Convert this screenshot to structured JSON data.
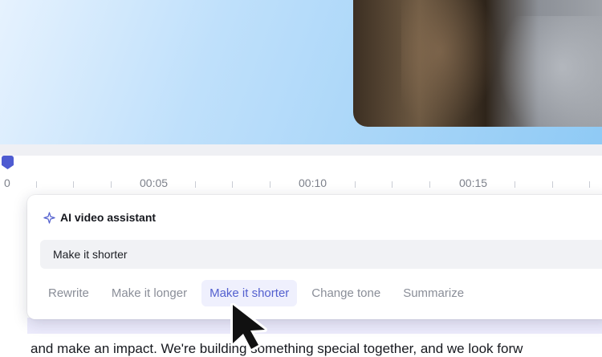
{
  "timeline": {
    "start_label": "0",
    "labels": [
      "00:05",
      "00:10",
      "00:15"
    ]
  },
  "assistant": {
    "title": "AI video assistant",
    "input_value": "Make it shorter",
    "actions": [
      "Rewrite",
      "Make it longer",
      "Make it shorter",
      "Change tone",
      "Summarize"
    ],
    "active_action": "Make it shorter"
  },
  "document": {
    "line": "and make an impact. We're building something special together, and we look forw"
  },
  "colors": {
    "accent": "#5360cf",
    "playhead": "#4e5bd1",
    "active_bg": "#eff0fd"
  },
  "icons": {
    "assistant": "sparkle-icon",
    "pointer": "mouse-pointer"
  }
}
